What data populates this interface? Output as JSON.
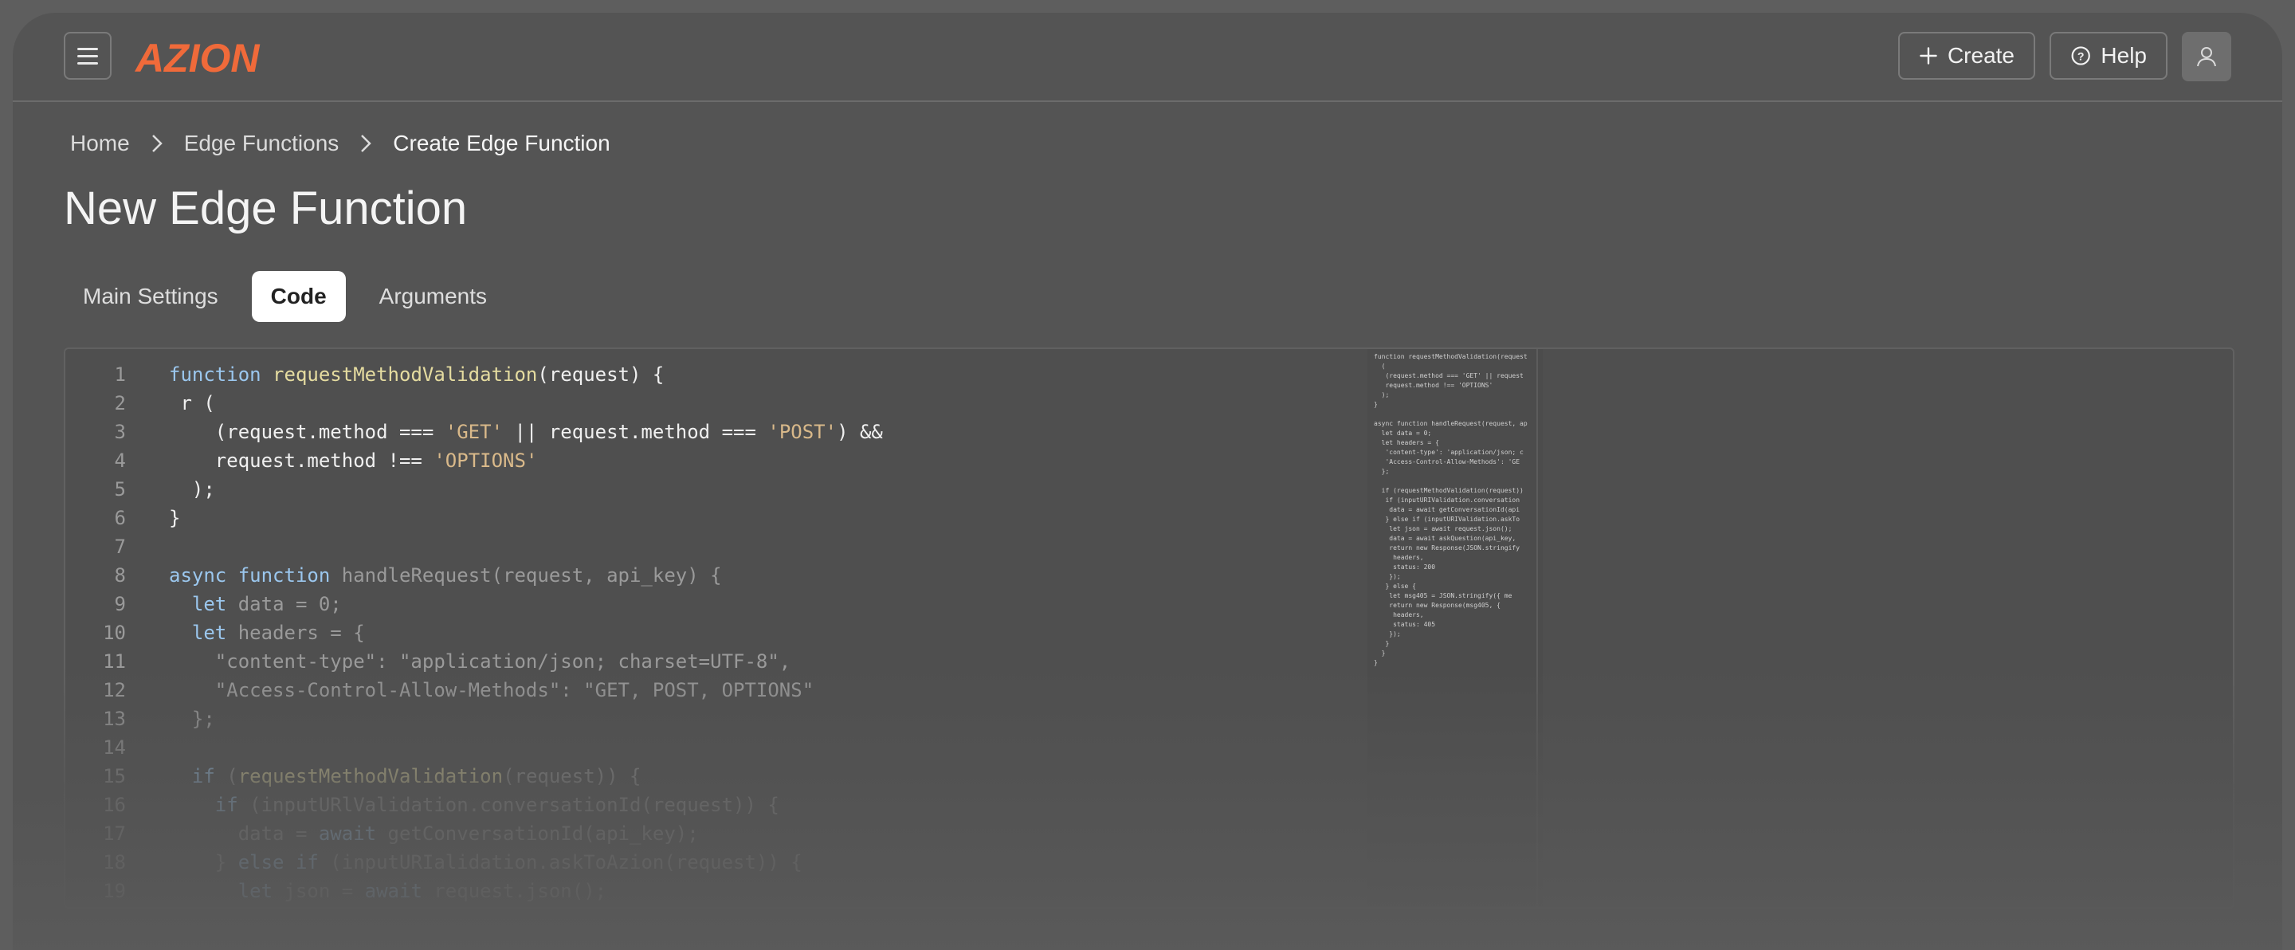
{
  "brand": {
    "logo_text": "AZION",
    "logo_color": "#f06a3a"
  },
  "header": {
    "create_label": "Create",
    "help_label": "Help"
  },
  "breadcrumb": [
    "Home",
    "Edge Functions",
    "Create Edge Function"
  ],
  "page_title": "New Edge Function",
  "tabs": [
    {
      "label": "Main Settings",
      "active": false
    },
    {
      "label": "Code",
      "active": true
    },
    {
      "label": "Arguments",
      "active": false
    }
  ],
  "code_lines": [
    {
      "n": "1",
      "text": "function requestMethodValidation(request) {"
    },
    {
      "n": "2",
      "text": " r ("
    },
    {
      "n": "3",
      "text": "    (request.method === 'GET' || request.method === 'POST') &&"
    },
    {
      "n": "4",
      "text": "    request.method !== 'OPTIONS'"
    },
    {
      "n": "5",
      "text": "  );"
    },
    {
      "n": "6",
      "text": "}"
    },
    {
      "n": "7",
      "text": ""
    },
    {
      "n": "8",
      "text": "async function handleRequest(request, api_key) {"
    },
    {
      "n": "9",
      "text": "  let data = 0;"
    },
    {
      "n": "10",
      "text": "  let headers = {"
    },
    {
      "n": "11",
      "text": "    \"content-type\": \"application/json; charset=UTF-8\","
    },
    {
      "n": "12",
      "text": "    \"Access-Control-Allow-Methods\": \"GET, POST, OPTIONS\""
    },
    {
      "n": "13",
      "text": "  };"
    },
    {
      "n": "14",
      "text": ""
    },
    {
      "n": "15",
      "text": "  if (requestMethodValidation(request)) {"
    },
    {
      "n": "16",
      "text": "    if (inputURlValidation.conversationId(request)) {"
    },
    {
      "n": "17",
      "text": "      data = await getConversationId(api_key);"
    },
    {
      "n": "18",
      "text": "    } else if (inputURIalidation.askToAzion(request)) {"
    },
    {
      "n": "19",
      "text": "      let json = await request.json();"
    }
  ],
  "minimap_lines": [
    "function requestMethodValidation(request",
    "  (",
    "   (request.method === 'GET' || request",
    "   request.method !== 'OPTIONS'",
    "  );",
    "}",
    "",
    "async function handleRequest(request, ap",
    "  let data = 0;",
    "  let headers = {",
    "   'content-type': 'application/json; c",
    "   'Access-Control-Allow-Methods': 'GE",
    "  };",
    "",
    "  if (requestMethodValidation(request))",
    "   if (inputURIValidation.conversation",
    "    data = await getConversationId(api",
    "   } else if (inputURIValidation.askTo",
    "    let json = await request.json();",
    "    data = await askQuestion(api_key,",
    "    return new Response(JSON.stringify",
    "     headers,",
    "     status: 200",
    "    });",
    "   } else {",
    "    let msg405 = JSON.stringify({ me",
    "    return new Response(msg405, {",
    "     headers,",
    "     status: 405",
    "    });",
    "   }",
    "  }",
    "}"
  ]
}
